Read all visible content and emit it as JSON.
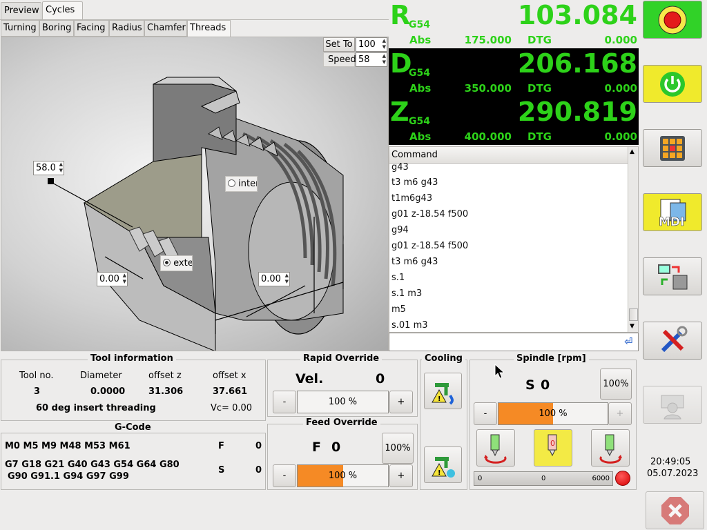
{
  "tabs": {
    "preview": "Preview",
    "cycles": "Cycles"
  },
  "subtabs": [
    "Turning",
    "Boring",
    "Facing",
    "Radius",
    "Chamfer",
    "Threads"
  ],
  "threads": {
    "set_to_label": "Set To",
    "set_to_value": "100",
    "speed_label": "Speed",
    "speed_value": "58",
    "angle_value": "58.0",
    "pitch_value": "0.00",
    "length_value": "0.00",
    "internal_label": "inter",
    "external_label": "exte"
  },
  "dro": {
    "axes": [
      {
        "letter": "R",
        "wcs": "G54",
        "value": "103.084",
        "abs_label": "Abs",
        "abs_value": "175.000",
        "dtg_label": "DTG",
        "dtg_value": "0.000"
      },
      {
        "letter": "D",
        "wcs": "G54",
        "value": "206.168",
        "abs_label": "Abs",
        "abs_value": "350.000",
        "dtg_label": "DTG",
        "dtg_value": "0.000"
      },
      {
        "letter": "Z",
        "wcs": "G54",
        "value": "290.819",
        "abs_label": "Abs",
        "abs_value": "400.000",
        "dtg_label": "DTG",
        "dtg_value": "0.000"
      }
    ]
  },
  "command": {
    "header": "Command",
    "history": [
      "g43",
      "t3 m6 g43",
      "t1m6g43",
      "g01 z-18.54 f500",
      "g94",
      "g01 z-18.54 f500",
      "t3 m6 g43",
      "s.1",
      "s.1 m3",
      "m5",
      "s.01 m3"
    ],
    "input_value": ""
  },
  "tool_info": {
    "title": "Tool information",
    "headers": [
      "Tool no.",
      "Diameter",
      "offset z",
      "offset x"
    ],
    "values": [
      "3",
      "0.0000",
      "31.306",
      "37.661"
    ],
    "description": "60 deg insert threading",
    "vc": "Vc= 0.00"
  },
  "gcode": {
    "title": "G-Code",
    "mcodes": "M0 M5 M9 M48 M53 M61",
    "gcodes_line1": "G7 G18 G21 G40 G43 G54 G64 G80",
    "gcodes_line2": "G90 G91.1 G94 G97 G99",
    "f_label": "F",
    "f_value": "0",
    "s_label": "S",
    "s_value": "0"
  },
  "rapid": {
    "title": "Rapid Override",
    "vel_label": "Vel.",
    "vel_value": "0",
    "minus": "-",
    "plus": "+",
    "bar_text": "100 %",
    "fraction": 0.0
  },
  "feed": {
    "title": "Feed Override",
    "f_label": "F",
    "f_value": "0",
    "reset": "100%",
    "minus": "-",
    "plus": "+",
    "bar_text": "100 %",
    "fraction": 0.5
  },
  "cooling": {
    "title": "Cooling"
  },
  "spindle": {
    "title": "Spindle [rpm]",
    "s_label": "S",
    "s_value": "0",
    "reset": "100%",
    "minus": "-",
    "plus": "+",
    "bar_text": "100 %",
    "fraction": 0.5,
    "gauge_min": "0",
    "gauge_value": "0",
    "gauge_max": "6000"
  },
  "clock": {
    "time": "20:49:05",
    "date": "05.07.2023"
  },
  "colors": {
    "accent": "#2dd219",
    "orange": "#f58a25",
    "estop_green": "#31d228",
    "power_yellow": "#f0ea2c"
  },
  "icons": [
    "emergency-stop-icon",
    "power-icon",
    "jog-arrows-icon",
    "mdi-icon",
    "machine-transfer-icon",
    "tools-icon",
    "user-icon",
    "close-icon"
  ]
}
